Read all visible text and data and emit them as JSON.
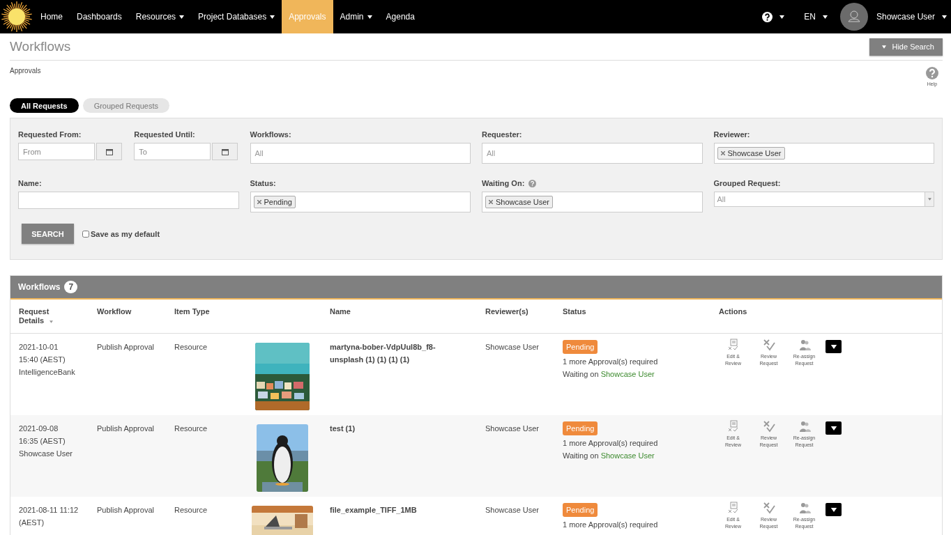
{
  "nav": {
    "items": [
      {
        "label": "Home",
        "dropdown": false,
        "selected": false
      },
      {
        "label": "Dashboards",
        "dropdown": false,
        "selected": false
      },
      {
        "label": "Resources",
        "dropdown": true,
        "selected": false
      },
      {
        "label": "Project Databases",
        "dropdown": true,
        "selected": false
      },
      {
        "label": "Approvals",
        "dropdown": false,
        "selected": true
      },
      {
        "label": "Admin",
        "dropdown": true,
        "selected": false
      },
      {
        "label": "Agenda",
        "dropdown": false,
        "selected": false
      }
    ],
    "language": "EN",
    "user": "Showcase User"
  },
  "page": {
    "title": "Workflows",
    "hide_search_button": "Hide Search",
    "breadcrumb": "Approvals",
    "help_label": "Help"
  },
  "tabs": [
    {
      "label": "All Requests",
      "selected": true
    },
    {
      "label": "Grouped Requests",
      "selected": false
    }
  ],
  "filters": [
    {
      "kind": "date",
      "label": "Requested From:",
      "placeholder": "From"
    },
    {
      "kind": "date",
      "label": "Requested Until:",
      "placeholder": "To"
    },
    {
      "kind": "tags",
      "label": "Workflows:",
      "placeholder": "All"
    },
    {
      "kind": "tags",
      "label": "Requester:",
      "placeholder": "All"
    },
    {
      "kind": "tags",
      "label": "Reviewer:",
      "tags": [
        "Showcase User"
      ]
    },
    {
      "kind": "text",
      "label": "Name:"
    },
    {
      "kind": "tags",
      "label": "Status:",
      "tags": [
        "Pending"
      ]
    },
    {
      "kind": "tags",
      "label": "Waiting On:",
      "info": true,
      "tags": [
        "Showcase User"
      ]
    },
    {
      "kind": "select",
      "label": "Grouped Request:",
      "placeholder": "All"
    }
  ],
  "search_button": "SEARCH",
  "save_default": {
    "label": "Save as my default",
    "checked": false
  },
  "table": {
    "title": "Workflows",
    "count": "7",
    "columns": [
      "Request Details",
      "Workflow",
      "Item Type",
      "",
      "Name",
      "Reviewer(s)",
      "Status",
      "Actions"
    ],
    "rows": [
      {
        "details": [
          "2021-10-01",
          "15:40 (AEST)",
          "IntelligenceBank"
        ],
        "workflow": "Publish Approval",
        "item_type": "Resource",
        "thumbnail": {
          "kind": "picture"
        },
        "name": "martyna-bober-VdpUul8b_f8-unsplash (1) (1) (1) (1)",
        "reviewer": "Showcase User",
        "status": {
          "label": "Pending",
          "note": "1 more Approval(s) required",
          "waiting_prefix": "Waiting on",
          "waiting_user": "Showcase User"
        },
        "actions": [
          {
            "kind": "edit",
            "label": "Edit & Review"
          },
          {
            "kind": "review",
            "label": "Review Request"
          },
          {
            "kind": "reassign",
            "label": "Re-assign Request"
          }
        ]
      },
      {
        "details": [
          "2021-09-08",
          "16:35 (AEST)",
          "Showcase User"
        ],
        "workflow": "Publish Approval",
        "item_type": "Resource",
        "thumbnail": {
          "kind": "picture"
        },
        "name": "test (1)",
        "reviewer": "Showcase User",
        "status": {
          "label": "Pending",
          "note": "1 more Approval(s) required",
          "waiting_prefix": "Waiting on",
          "waiting_user": "Showcase User"
        },
        "actions": [
          {
            "kind": "edit",
            "label": "Edit & Review"
          },
          {
            "kind": "review",
            "label": "Review Request"
          },
          {
            "kind": "reassign",
            "label": "Re-assign Request"
          }
        ]
      },
      {
        "details": [
          "2021-08-11 11:12",
          "(AEST)"
        ],
        "workflow": "Publish Approval",
        "item_type": "Resource",
        "thumbnail": {
          "kind": "picture"
        },
        "name": "file_example_TIFF_1MB",
        "reviewer": "Showcase User",
        "status": {
          "label": "Pending",
          "note": "1 more Approval(s) required"
        },
        "actions": [
          {
            "kind": "edit",
            "label": "Edit & Review"
          },
          {
            "kind": "review",
            "label": "Review Request"
          },
          {
            "kind": "reassign",
            "label": "Re-assign Request"
          }
        ]
      }
    ]
  }
}
